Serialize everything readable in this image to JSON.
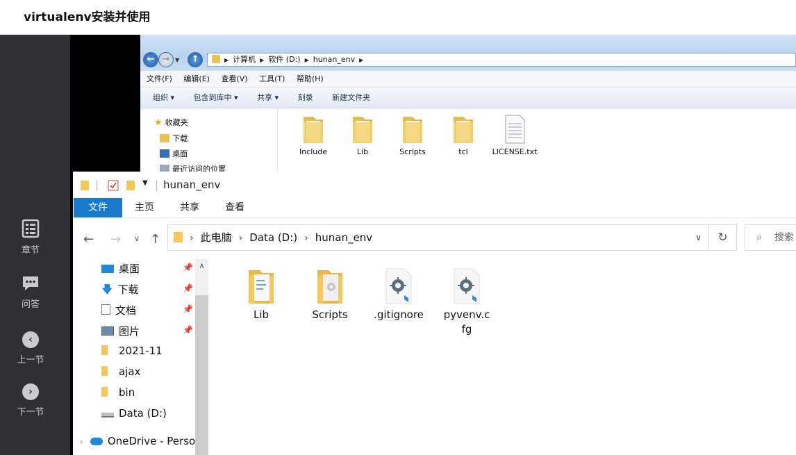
{
  "page": {
    "title": "virtualenv安装并使用"
  },
  "sidebar": {
    "items": [
      {
        "label": "章节",
        "icon": "chapter-list-icon"
      },
      {
        "label": "问答",
        "icon": "qa-chat-icon"
      },
      {
        "label": "上一节",
        "icon": "chevron-left-icon"
      },
      {
        "label": "下一节",
        "icon": "chevron-right-icon"
      }
    ]
  },
  "win7": {
    "path": [
      "计算机",
      "软件 (D:)",
      "hunan_env"
    ],
    "menu": [
      "文件(F)",
      "编辑(E)",
      "查看(V)",
      "工具(T)",
      "帮助(H)"
    ],
    "toolbar": [
      "组织 ▾",
      "包含到库中 ▾",
      "共享 ▾",
      "刻录",
      "新建文件夹"
    ],
    "nav": [
      "收藏夹",
      "下载",
      "桌面",
      "最近访问的位置"
    ],
    "files": [
      {
        "name": "Include",
        "type": "folder"
      },
      {
        "name": "Lib",
        "type": "folder"
      },
      {
        "name": "Scripts",
        "type": "folder"
      },
      {
        "name": "tcl",
        "type": "folder"
      },
      {
        "name": "LICENSE.txt",
        "type": "text"
      }
    ]
  },
  "win10": {
    "title": "hunan_env",
    "ribbon_tabs": [
      "文件",
      "主页",
      "共享",
      "查看"
    ],
    "path": [
      "此电脑",
      "Data (D:)",
      "hunan_env"
    ],
    "search_placeholder": "搜索",
    "nav": [
      {
        "label": "桌面",
        "pinned": true
      },
      {
        "label": "下载",
        "pinned": true
      },
      {
        "label": "文档",
        "pinned": true
      },
      {
        "label": "图片",
        "pinned": true
      },
      {
        "label": "2021-11",
        "pinned": false
      },
      {
        "label": "ajax",
        "pinned": false
      },
      {
        "label": "bin",
        "pinned": false
      },
      {
        "label": "Data (D:)",
        "pinned": false
      },
      {
        "label": "OneDrive - Perso",
        "pinned": false
      }
    ],
    "files": [
      {
        "name": "Lib",
        "type": "folder"
      },
      {
        "name": "Scripts",
        "type": "folder"
      },
      {
        "name": ".gitignore",
        "type": "config"
      },
      {
        "name": "pyvenv.cfg",
        "type": "config"
      }
    ]
  },
  "colors": {
    "sidebar_bg": "#2e3033",
    "ribbon_active": "#1979ca",
    "folder": "#f3c75a"
  }
}
